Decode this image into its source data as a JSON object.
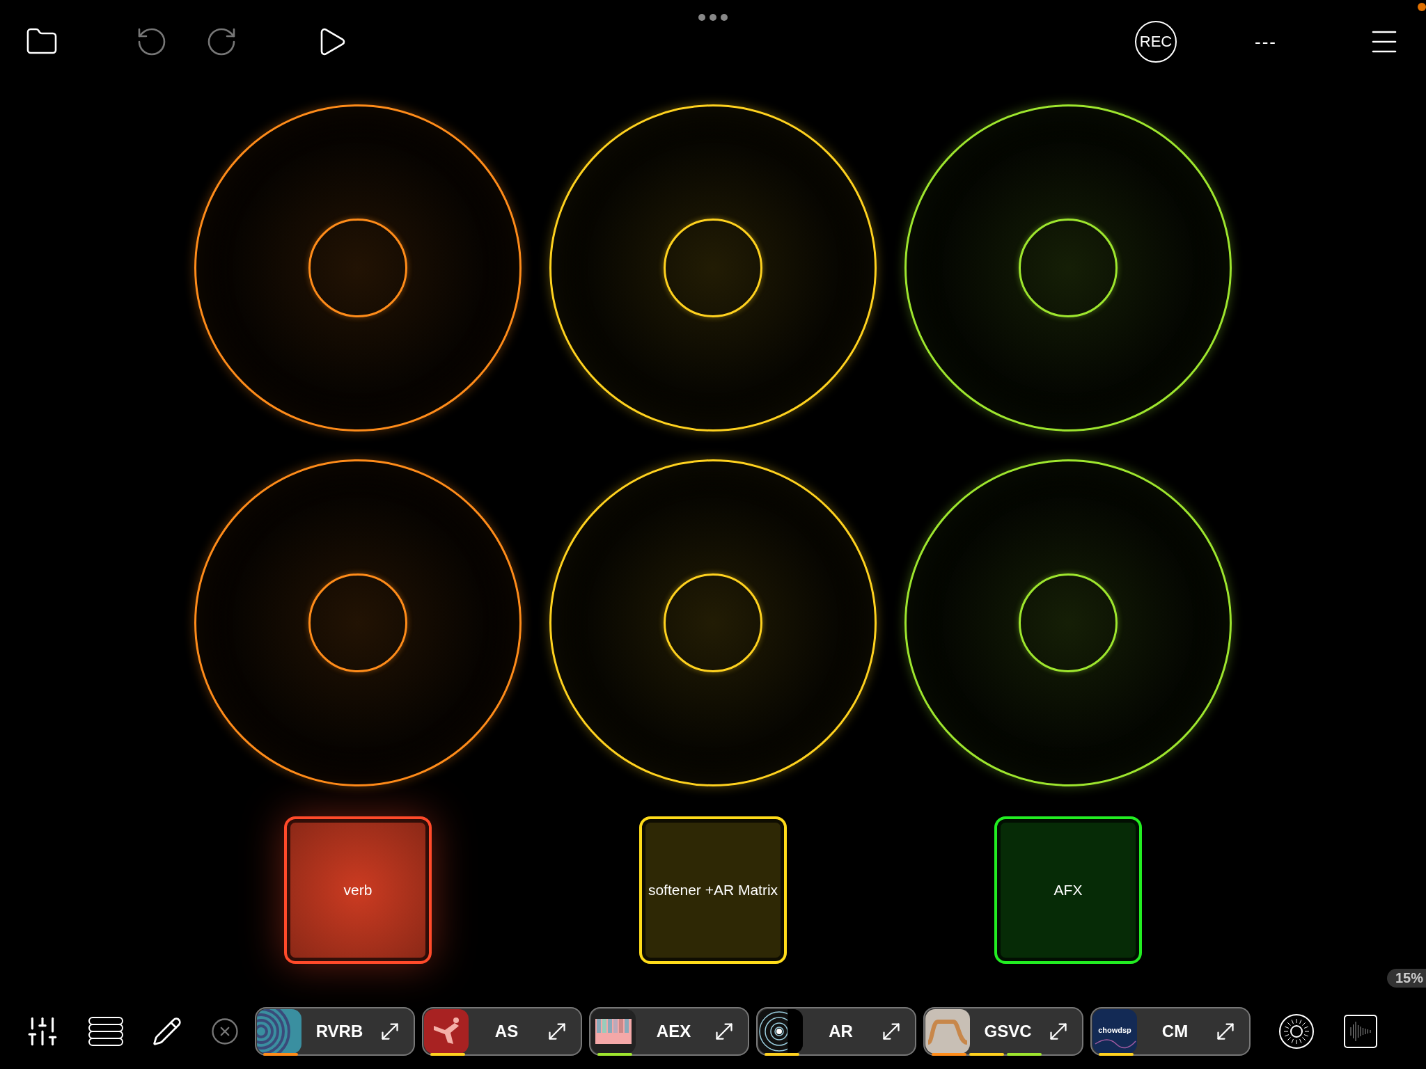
{
  "toolbar": {
    "undo": {
      "disabled": true
    },
    "redo": {
      "disabled": true
    },
    "rec_label": "REC",
    "status_text": "---"
  },
  "rings": [
    {
      "color": "#ff8c1a"
    },
    {
      "color": "#ffd21f"
    },
    {
      "color": "#9ee62e"
    },
    {
      "color": "#ff8c1a"
    },
    {
      "color": "#ffd21f"
    },
    {
      "color": "#9ee62e"
    }
  ],
  "pads": [
    {
      "label": "verb",
      "color": "#ff4a2a",
      "selected": true
    },
    {
      "label": "softener +AR Matrix",
      "color": "#ffdc1a",
      "selected": false
    },
    {
      "label": "AFX",
      "color": "#22ee22",
      "selected": false
    }
  ],
  "cpu_badge": "15%",
  "plugins": [
    {
      "label": "RVRB",
      "kind": "rings",
      "meters": [
        {
          "color": "#ff8c1a"
        }
      ]
    },
    {
      "label": "AS",
      "kind": "dancer",
      "meters": [
        {
          "color": "#ffd21f"
        }
      ]
    },
    {
      "label": "AEX",
      "kind": "keys",
      "meters": [
        {
          "color": "#9ee62e"
        }
      ]
    },
    {
      "label": "AR",
      "kind": "sonar",
      "meters": [
        {
          "color": "#ffd21f"
        }
      ]
    },
    {
      "label": "GSVC",
      "kind": "curve",
      "meters": [
        {
          "color": "#ff8c1a"
        },
        {
          "color": "#ffd21f"
        },
        {
          "color": "#9ee62e"
        }
      ]
    },
    {
      "label": "CM",
      "kind": "logo",
      "thumb_text": "chowdsp",
      "meters": [
        {
          "color": "#ffd21f"
        }
      ]
    }
  ]
}
